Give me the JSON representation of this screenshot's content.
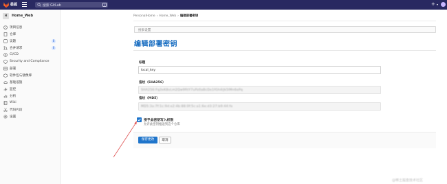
{
  "topbar": {
    "brand": "极狐",
    "search_placeholder": "搜索 GitLab",
    "kbd_hint": "/",
    "plus": "+"
  },
  "sidebar": {
    "project_avatar": "H",
    "project_name": "Home_Web",
    "items": [
      {
        "label": "项目信息",
        "icon": "info-icon"
      },
      {
        "label": "仓库",
        "icon": "doc-icon"
      },
      {
        "label": "议题",
        "icon": "issues-icon",
        "badge": "0"
      },
      {
        "label": "合并请求",
        "icon": "merge-request-icon",
        "badge": "0"
      },
      {
        "label": "CI/CD",
        "icon": "rocket-icon"
      },
      {
        "label": "Security and Compliance",
        "icon": "shield-icon"
      },
      {
        "label": "部署",
        "icon": "deploy-icon"
      },
      {
        "label": "软件包与镜像库",
        "icon": "package-icon"
      },
      {
        "label": "基础设施",
        "icon": "cloud-icon"
      },
      {
        "label": "监控",
        "icon": "monitor-icon"
      },
      {
        "label": "分析",
        "icon": "chart-icon"
      },
      {
        "label": "Wiki",
        "icon": "book-icon"
      },
      {
        "label": "代码片段",
        "icon": "snippet-icon"
      },
      {
        "label": "设置",
        "icon": "gear-icon"
      }
    ]
  },
  "breadcrumb": {
    "items": [
      "PersonalHome",
      "Home_Web"
    ],
    "current": "编辑部署密钥",
    "separator": "›"
  },
  "settings_search_placeholder": "搜索设置",
  "page_title": "编辑部署密钥",
  "form": {
    "title_label": "标题",
    "title_value": "local_key",
    "sha256_label": "指纹（SHA256）",
    "sha256_value": "SHA256:Fq3xK8vLm2Qw9RtY7uPz0aBcDe1fGh4iJk5lMn6oPq",
    "md5_label": "指纹（MD5）",
    "md5_value": "MD5:3a:7f:1c:9d:e2:4b:88:0f:5c:a1:6e:d3:27:b9:44:fe",
    "write_access_label": "授予此密钥写入权限",
    "write_access_help": "允许此密钥推送到这个仓库",
    "write_access_checked": true,
    "save_label": "保存更改",
    "cancel_label": "取消"
  },
  "watermark": "@稀土掘金技术社区",
  "colors": {
    "nav_bg": "#292961",
    "accent": "#1f75cb",
    "title": "#1068bf",
    "annotation_arrow": "#e05555"
  }
}
